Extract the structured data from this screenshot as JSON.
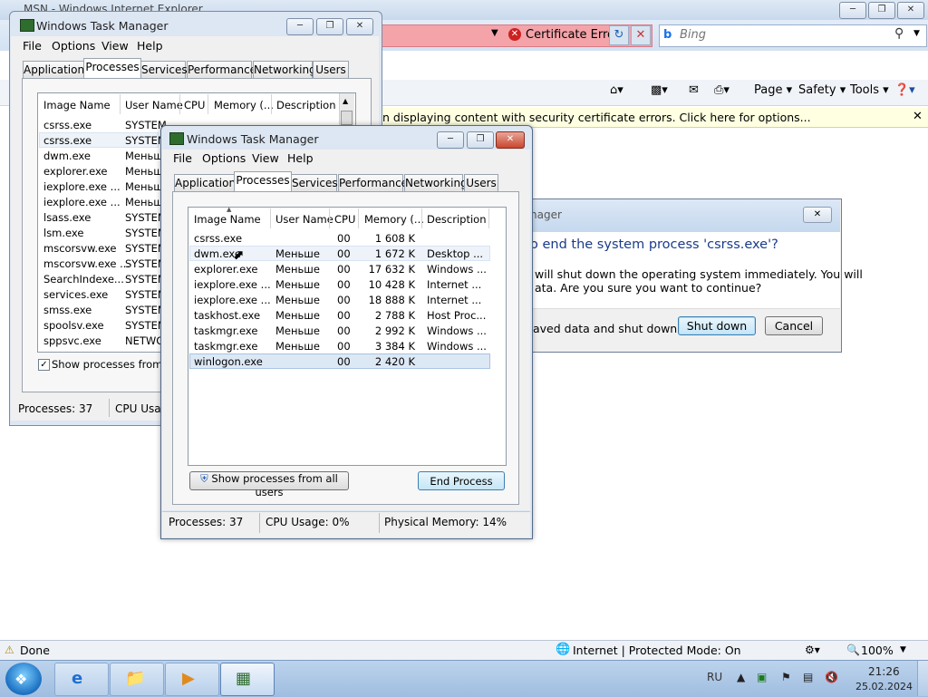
{
  "ie": {
    "title": "MSN - Windows Internet Explorer",
    "cert_error": "Certificate Error",
    "search_placeholder": "Bing",
    "commands": [
      "Page",
      "Safety",
      "Tools"
    ],
    "infobar": "n displaying content with security certificate errors. Click here for options...",
    "status_done": "Done",
    "status_zone": "Internet | Protected Mode: On",
    "zoom": "100%"
  },
  "dialog": {
    "title": "nager",
    "question": "o end the system process 'csrss.exe'?",
    "text1": "will shut down the operating system immediately.  You will",
    "text2": "ata.  Are you sure you want to continue?",
    "checkbox_text": "aved data and shut down.",
    "shutdown_button": "Shut down",
    "cancel_button": "Cancel"
  },
  "tm_back": {
    "title": "Windows Task Manager",
    "menu": [
      "File",
      "Options",
      "View",
      "Help"
    ],
    "tabs": [
      "Applications",
      "Processes",
      "Services",
      "Performance",
      "Networking",
      "Users"
    ],
    "columns": [
      "Image Name",
      "User Name",
      "CPU",
      "Memory (...",
      "Description"
    ],
    "rows": [
      {
        "name": "csrss.exe",
        "user": "SYSTEM"
      },
      {
        "name": "csrss.exe",
        "user": "SYSTEM"
      },
      {
        "name": "dwm.exe",
        "user": "Меньше"
      },
      {
        "name": "explorer.exe",
        "user": "Меньше"
      },
      {
        "name": "iexplore.exe ...",
        "user": "Меньше"
      },
      {
        "name": "iexplore.exe ...",
        "user": "Меньше"
      },
      {
        "name": "lsass.exe",
        "user": "SYSTEM"
      },
      {
        "name": "lsm.exe",
        "user": "SYSTEM"
      },
      {
        "name": "mscorsvw.exe",
        "user": "SYSTEM"
      },
      {
        "name": "mscorsvw.exe ...",
        "user": "SYSTEM"
      },
      {
        "name": "SearchIndexe...",
        "user": "SYSTEM"
      },
      {
        "name": "services.exe",
        "user": "SYSTEM"
      },
      {
        "name": "smss.exe",
        "user": "SYSTEM"
      },
      {
        "name": "spoolsv.exe",
        "user": "SYSTEM"
      },
      {
        "name": "sppsvc.exe",
        "user": "NETWO"
      }
    ],
    "show_all_text": "Show processes from all",
    "status_processes": "Processes: 37",
    "status_cpu": "CPU Usag"
  },
  "tm_front": {
    "title": "Windows Task Manager",
    "menu": [
      "File",
      "Options",
      "View",
      "Help"
    ],
    "tabs": [
      "Applications",
      "Processes",
      "Services",
      "Performance",
      "Networking",
      "Users"
    ],
    "columns": [
      "Image Name",
      "User Name",
      "CPU",
      "Memory (...",
      "Description"
    ],
    "rows": [
      {
        "name": "csrss.exe",
        "user": "",
        "cpu": "00",
        "mem": "1 608 K",
        "desc": ""
      },
      {
        "name": "dwm.exe",
        "user": "Меньше",
        "cpu": "00",
        "mem": "1 672 K",
        "desc": "Desktop ..."
      },
      {
        "name": "explorer.exe",
        "user": "Меньше",
        "cpu": "00",
        "mem": "17 632 K",
        "desc": "Windows ..."
      },
      {
        "name": "iexplore.exe ...",
        "user": "Меньше",
        "cpu": "00",
        "mem": "10 428 K",
        "desc": "Internet ..."
      },
      {
        "name": "iexplore.exe ...",
        "user": "Меньше",
        "cpu": "00",
        "mem": "18 888 K",
        "desc": "Internet ..."
      },
      {
        "name": "taskhost.exe",
        "user": "Меньше",
        "cpu": "00",
        "mem": "2 788 K",
        "desc": "Host Proc..."
      },
      {
        "name": "taskmgr.exe",
        "user": "Меньше",
        "cpu": "00",
        "mem": "2 992 K",
        "desc": "Windows ..."
      },
      {
        "name": "taskmgr.exe",
        "user": "Меньше",
        "cpu": "00",
        "mem": "3 384 K",
        "desc": "Windows ..."
      },
      {
        "name": "winlogon.exe",
        "user": "",
        "cpu": "00",
        "mem": "2 420 K",
        "desc": ""
      }
    ],
    "show_all_button": "Show processes from all users",
    "end_process_button": "End Process",
    "status_processes": "Processes: 37",
    "status_cpu": "CPU Usage: 0%",
    "status_memory": "Physical Memory: 14%"
  },
  "taskbar": {
    "lang": "RU",
    "time": "21:26",
    "date": "25.02.2024"
  }
}
